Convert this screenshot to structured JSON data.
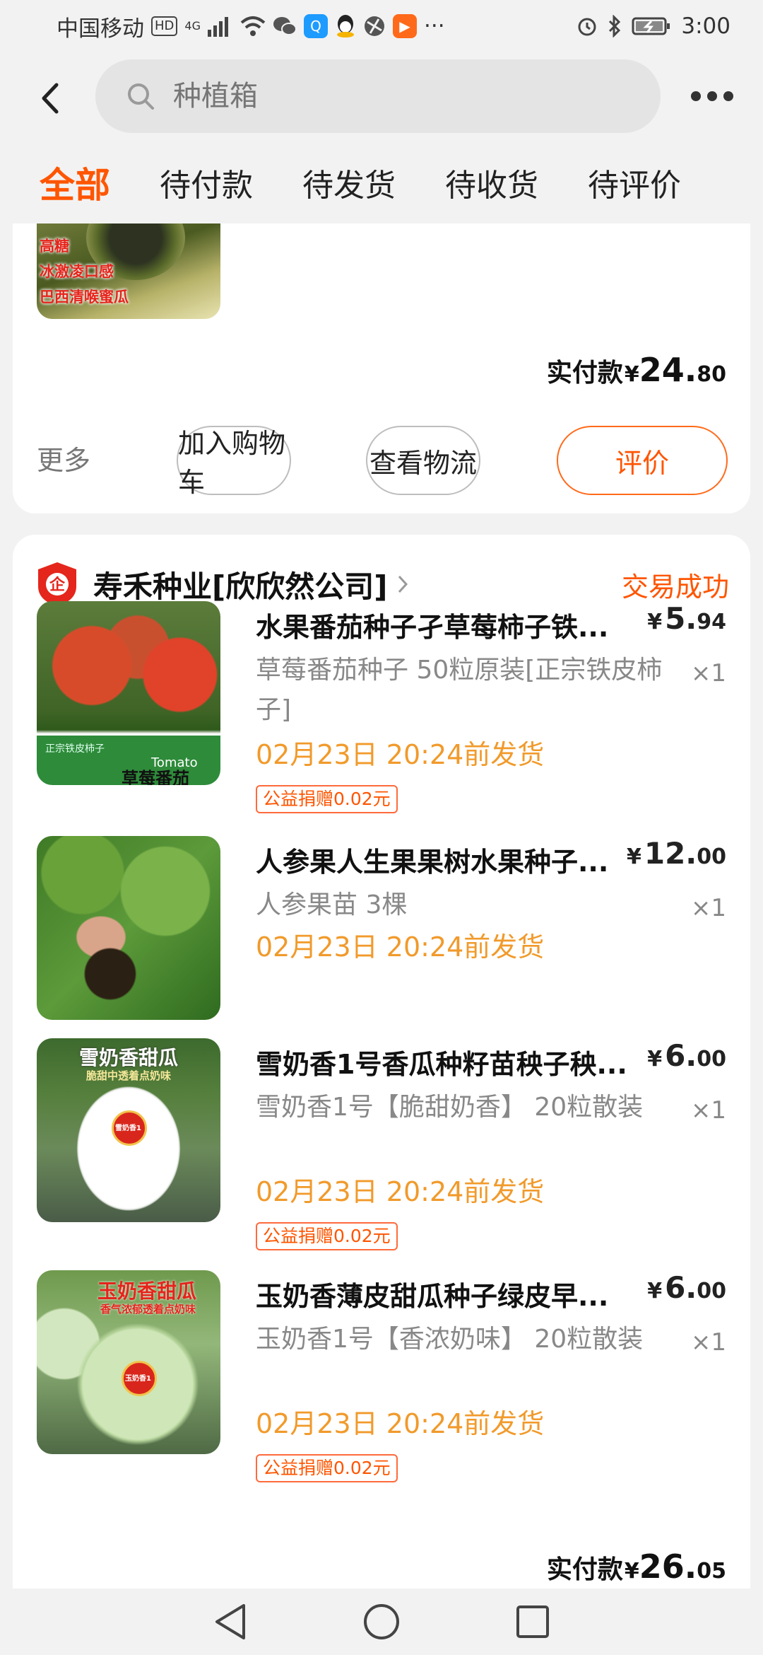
{
  "status_bar": {
    "carrier": "中国移动",
    "hd": "HD",
    "network": "4G",
    "time": "3:00",
    "more": "···"
  },
  "search": {
    "placeholder": "种植箱"
  },
  "tabs": [
    {
      "label": "全部",
      "active": true
    },
    {
      "label": "待付款",
      "active": false
    },
    {
      "label": "待发货",
      "active": false
    },
    {
      "label": "待收货",
      "active": false
    },
    {
      "label": "待评价",
      "active": false
    }
  ],
  "prev_order": {
    "image_texts": [
      "高糖",
      "冰激凌口感",
      "巴西清喉蜜瓜"
    ],
    "paid_label": "实付款",
    "currency": "¥",
    "paid_int": "24.",
    "paid_dec": "80",
    "more": "更多",
    "buttons": [
      "加入购物车",
      "查看物流",
      "评价"
    ]
  },
  "order": {
    "shop_name": "寿禾种业[欣欣然公司]",
    "status": "交易成功",
    "currency": "¥",
    "paid_label": "实付款",
    "paid_int": "26.",
    "paid_dec": "05",
    "items": [
      {
        "title": "水果番茄种子孑草莓柿子铁...",
        "price_int": "5.",
        "price_dec": "94",
        "spec": "草莓番茄种子 50粒原装[正宗铁皮柿子]",
        "qty": "×1",
        "ship": "02月23日 20:24前发货",
        "badge": "公益捐赠0.02元",
        "image_texts": [
          "正宗铁皮柿子",
          "Tomato",
          "草莓番茄"
        ]
      },
      {
        "title": "人参果人生果果树水果种子...",
        "price_int": "12.",
        "price_dec": "00",
        "spec": "人参果苗 3棵",
        "qty": "×1",
        "ship": "02月23日 20:24前发货",
        "badge": ""
      },
      {
        "title": "雪奶香1号香瓜种籽苗秧子秧...",
        "price_int": "6.",
        "price_dec": "00",
        "spec": "雪奶香1号【脆甜奶香】 20粒散装",
        "qty": "×1",
        "ship": "02月23日 20:24前发货",
        "badge": "公益捐赠0.02元",
        "image_texts": [
          "雪奶香甜瓜",
          "脆甜中透着点奶味",
          "雪奶香1"
        ]
      },
      {
        "title": "玉奶香薄皮甜瓜种子绿皮早...",
        "price_int": "6.",
        "price_dec": "00",
        "spec": "玉奶香1号【香浓奶味】 20粒散装",
        "qty": "×1",
        "ship": "02月23日 20:24前发货",
        "badge": "公益捐赠0.02元",
        "image_texts": [
          "玉奶香甜瓜",
          "香气浓郁透着点奶味",
          "玉奶香1"
        ]
      }
    ]
  },
  "colors": {
    "accent": "#ff5500",
    "ship": "#f19a2b",
    "background": "#f2f2f2"
  }
}
